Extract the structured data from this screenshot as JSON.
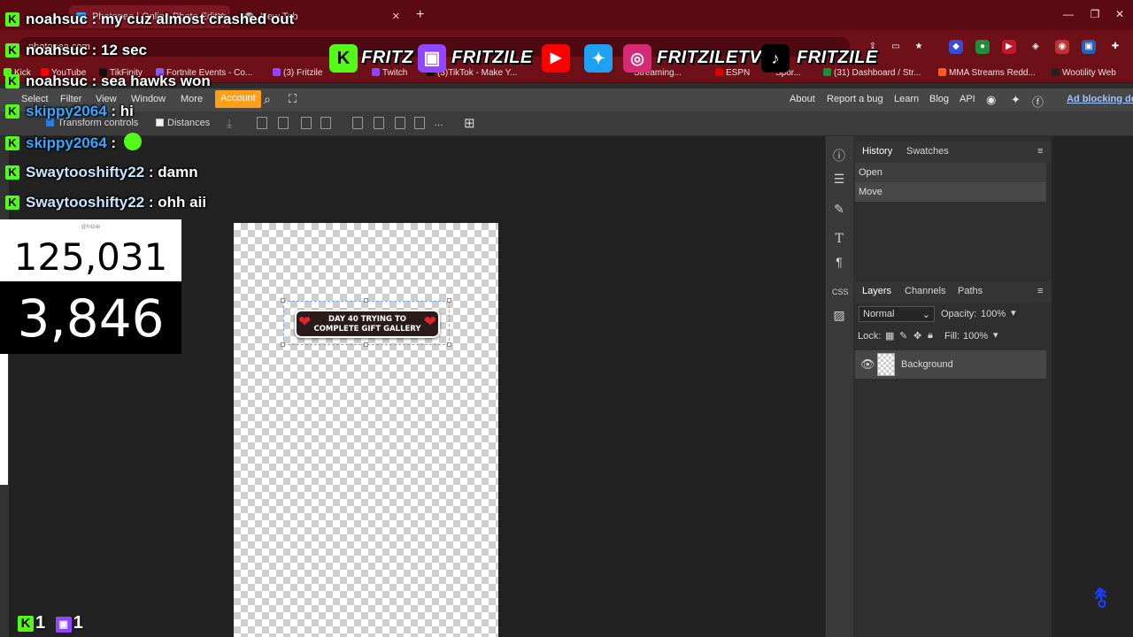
{
  "browser": {
    "tabs": [
      {
        "title": "Photopea | Online Photo Editor",
        "active": true
      },
      {
        "title": "New Tab",
        "active": false
      }
    ],
    "url": "photopea.com",
    "bookmarks": [
      "Kick",
      "YouTube",
      "TikFinity",
      "Fortnite Events - Co...",
      "(3) Fritzile",
      "Twitch",
      "(3)TikTok - Make Y...",
      "Streaming...",
      "ESPN",
      "Spor...",
      "(31) Dashboard / Str...",
      "MMA Streams Redd...",
      "Wootility Web"
    ]
  },
  "photopea": {
    "menu": [
      "Select",
      "Filter",
      "View",
      "Window",
      "More"
    ],
    "account_label": "Account",
    "right_menu": [
      "About",
      "Report a bug",
      "Learn",
      "Blog",
      "API"
    ],
    "ad_text": "Ad blocking det",
    "options": {
      "transform_controls": "Transform controls",
      "distances": "Distances"
    },
    "canvas_text": {
      "line1": "DAY 40 TRYING TO",
      "line2": "COMPLETE GIFT GALLERY"
    },
    "history_tabs": [
      "History",
      "Swatches"
    ],
    "history_items": [
      "Open",
      "Move"
    ],
    "layers_tabs": [
      "Layers",
      "Channels",
      "Paths"
    ],
    "blend_mode": "Normal",
    "opacity_label": "Opacity:",
    "opacity_value": "100%",
    "lock_label": "Lock:",
    "fill_label": "Fill:",
    "fill_value": "100%",
    "layers": [
      {
        "name": "Background"
      }
    ]
  },
  "overlay": {
    "chat": [
      {
        "user": "noahsuc",
        "sep": " : ",
        "message": "my cuz almost crashed out",
        "color": "#ffffff"
      },
      {
        "user": "noahsuc",
        "sep": " : ",
        "message": "12 sec",
        "color": "#ffffff"
      },
      {
        "user": "noahsuc",
        "sep": " : ",
        "message": "sea hawks won",
        "color": "#ffffff"
      },
      {
        "user": "skippy2064",
        "sep": " : ",
        "message": "hi",
        "color": "#3aa7ff"
      },
      {
        "user": "skippy2064",
        "sep": " : ",
        "message": "",
        "color": "#3aa7ff"
      },
      {
        "user": "Swaytooshifty22",
        "sep": " : ",
        "message": "damn",
        "color": "#c9e7ff"
      },
      {
        "user": "Swaytooshifty22",
        "sep": " : ",
        "message": "ohh aii",
        "color": "#c9e7ff"
      }
    ],
    "social_handles": [
      "FRITZ",
      "FRITZILE",
      "FRITZILETV",
      "FRITZILE"
    ],
    "counter_handle": "@fritzile",
    "counter_top": "125,031",
    "counter_bottom": "3,846",
    "viewer_kick": "1",
    "viewer_twitch": "1"
  }
}
